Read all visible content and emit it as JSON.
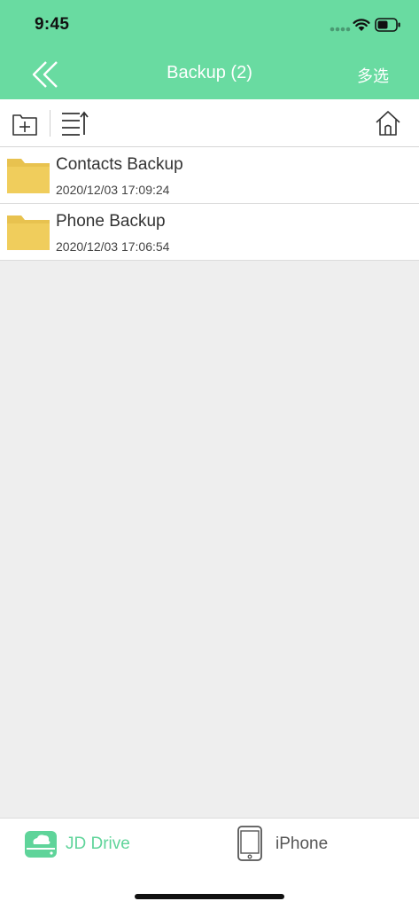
{
  "status_bar": {
    "time": "9:45"
  },
  "header": {
    "title": "Backup (2)",
    "multi_select_label": "多选",
    "background_color": "#69dba1"
  },
  "toolbar": {
    "icons": [
      "new-folder-icon",
      "sort-icon",
      "home-icon"
    ]
  },
  "files": [
    {
      "name": "Contacts Backup",
      "date": "2020/12/03 17:09:24",
      "icon": "folder-icon"
    },
    {
      "name": "Phone Backup",
      "date": "2020/12/03 17:06:54",
      "icon": "folder-icon"
    }
  ],
  "tab_bar": {
    "tabs": [
      {
        "label": "JD Drive",
        "icon": "cloud-drive-icon",
        "active": true
      },
      {
        "label": "iPhone",
        "icon": "phone-icon",
        "active": false
      }
    ],
    "active_color": "#5fd49a"
  }
}
